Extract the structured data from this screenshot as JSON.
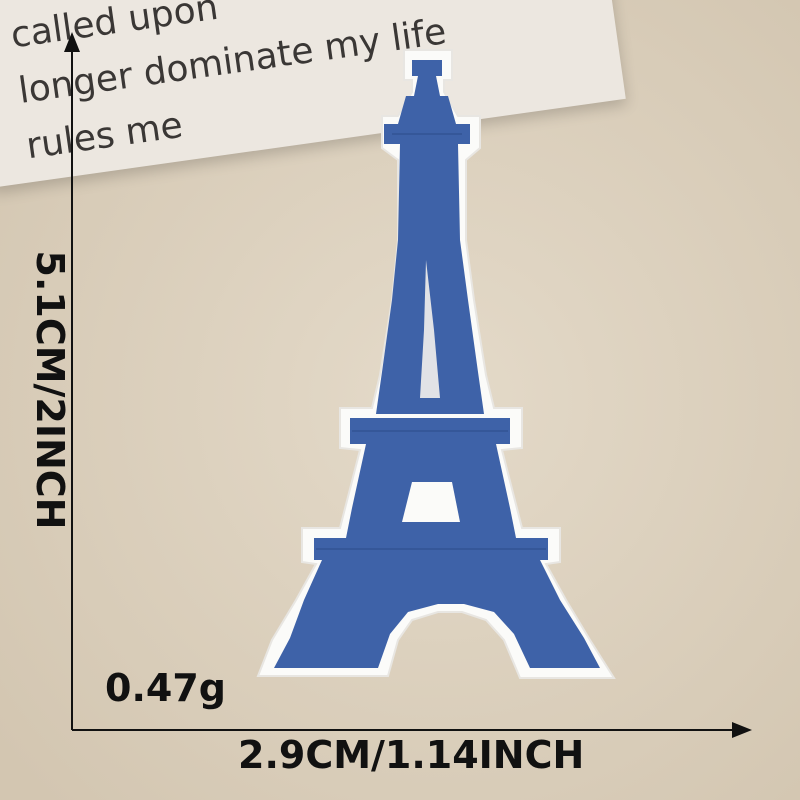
{
  "card": {
    "line1": "called upon",
    "line2": "longer dominate my life",
    "line3": "rules me"
  },
  "patch": {
    "subject": "Eiffel Tower embroidered patch",
    "thread_color": "#3e62a8",
    "border_color": "#ffffff"
  },
  "measurements": {
    "width_label": "2.9CM/1.14INCH",
    "height_label": "5.1CM/2INCH",
    "weight_label": "0.47g"
  },
  "colors": {
    "background": "#ddd2c0",
    "card": "#ece7e0",
    "text": "#111111"
  }
}
